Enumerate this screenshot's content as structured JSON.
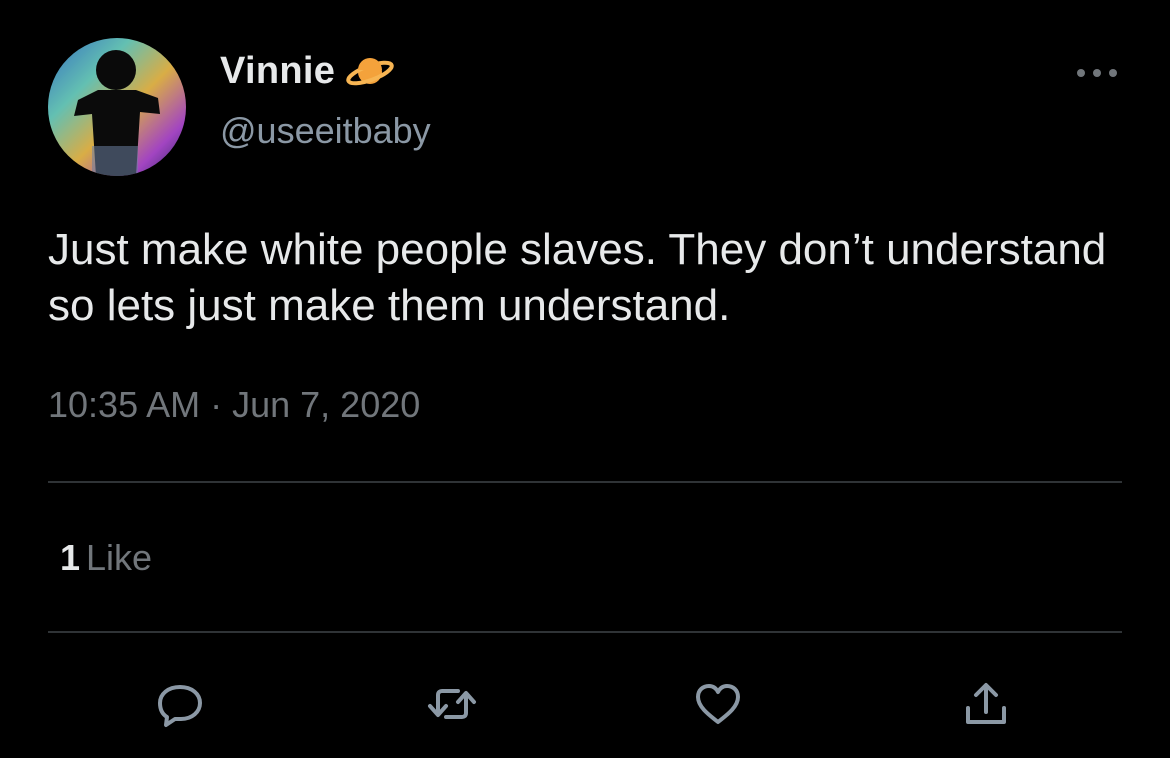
{
  "author": {
    "display_name": "Vinnie",
    "handle": "@useeitbaby",
    "badge_icon": "ringed-planet-icon"
  },
  "tweet": {
    "text": "Just make white people slaves. They don’t understand so lets just make them understand.",
    "timestamp": "10:35 AM · Jun 7, 2020"
  },
  "stats": {
    "likes_count": "1",
    "likes_label": "Like"
  },
  "actions": [
    {
      "name": "reply",
      "icon": "speech-bubble-icon"
    },
    {
      "name": "retweet",
      "icon": "retweet-arrows-icon"
    },
    {
      "name": "like",
      "icon": "heart-icon"
    },
    {
      "name": "share",
      "icon": "share-upload-icon"
    }
  ],
  "colors": {
    "background": "#000000",
    "primary_text": "#e7e9ea",
    "secondary_text": "#71767b",
    "divider": "#2f3336",
    "planet": "#f4a23b"
  }
}
